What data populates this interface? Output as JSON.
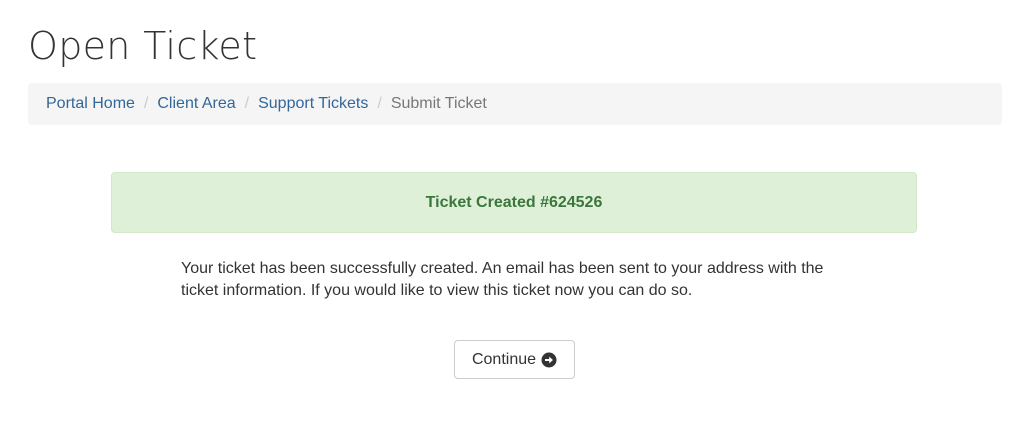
{
  "page": {
    "title": "Open Ticket"
  },
  "breadcrumb": {
    "items": [
      {
        "label": "Portal Home",
        "link": true
      },
      {
        "label": "Client Area",
        "link": true
      },
      {
        "label": "Support Tickets",
        "link": true
      },
      {
        "label": "Submit Ticket",
        "link": false
      }
    ],
    "separator": "/"
  },
  "alert": {
    "text": "Ticket Created #624526",
    "bg_color": "#dff0d8",
    "text_color": "#3c763d"
  },
  "message": {
    "text": "Your ticket has been successfully created. An email has been sent to your address with the ticket information. If you would like to view this ticket now you can do so."
  },
  "continue_button": {
    "label": "Continue",
    "icon": "arrow-circle-right-icon"
  },
  "colors": {
    "link": "#336699",
    "breadcrumb_bg": "#f5f5f5"
  }
}
